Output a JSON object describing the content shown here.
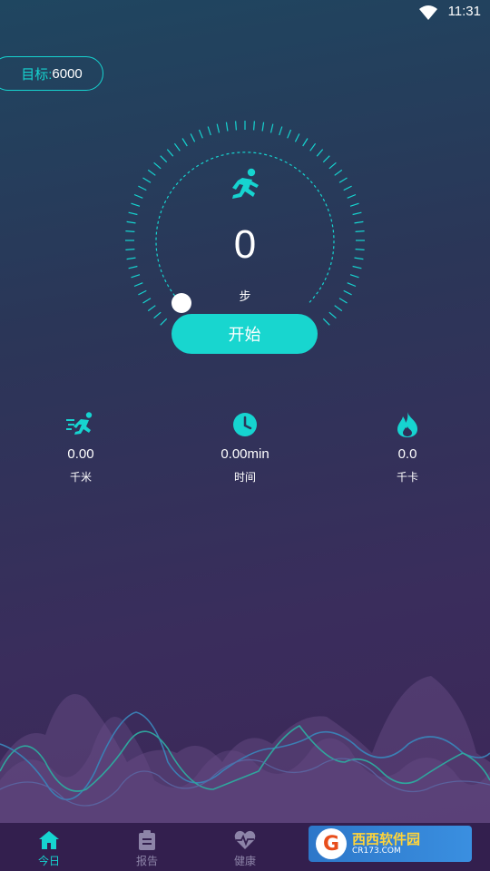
{
  "status_bar": {
    "time": "11:31"
  },
  "goal": {
    "label": "目标:",
    "value": "6000"
  },
  "pedometer": {
    "steps": "0",
    "unit": "步",
    "start_label": "开始"
  },
  "stats": [
    {
      "icon": "running-fast-icon",
      "value": "0.00",
      "label": "千米"
    },
    {
      "icon": "clock-icon",
      "value": "0.00min",
      "label": "时间"
    },
    {
      "icon": "flame-icon",
      "value": "0.0",
      "label": "千卡"
    }
  ],
  "tabs": [
    {
      "icon": "home-icon",
      "label": "今日",
      "active": true
    },
    {
      "icon": "clipboard-icon",
      "label": "报告"
    },
    {
      "icon": "heartbeat-icon",
      "label": "健康"
    },
    {
      "icon": "tools-icon",
      "label": ""
    },
    {
      "icon": "profile-icon",
      "label": ""
    }
  ],
  "watermark": {
    "logo": "G",
    "title": "西西软件园",
    "subtitle": "CR173.COM"
  },
  "colors": {
    "accent": "#16d4d0",
    "tab_bg": "#331f4e"
  }
}
